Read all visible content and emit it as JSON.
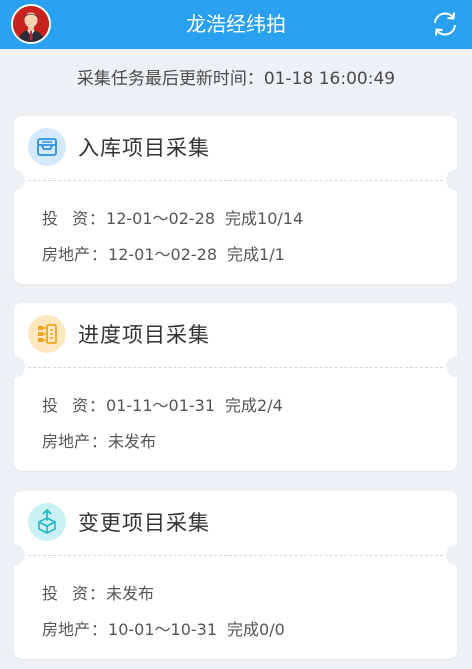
{
  "header": {
    "title": "龙浩经纬拍",
    "color": "#2aa0f0"
  },
  "update_text": "采集任务最后更新时间：01-18 16:00:49",
  "cards": [
    {
      "title": "入库项目采集",
      "icon": "inbox-tray-icon",
      "rows": [
        {
          "label": "投资",
          "period": "12-01～02-28",
          "status": "完成10/14"
        },
        {
          "label": "房地产",
          "period": "12-01～02-28",
          "status": "完成1/1"
        }
      ]
    },
    {
      "title": "进度项目采集",
      "icon": "progress-flow-icon",
      "rows": [
        {
          "label": "投资",
          "period": "01-11～01-31",
          "status": "完成2/4"
        },
        {
          "label": "房地产",
          "period": "未发布",
          "status": ""
        }
      ]
    },
    {
      "title": "变更项目采集",
      "icon": "box-change-icon",
      "rows": [
        {
          "label": "投资",
          "period": "未发布",
          "status": ""
        },
        {
          "label": "房地产",
          "period": "10-01～10-31",
          "status": "完成0/0"
        }
      ]
    }
  ]
}
